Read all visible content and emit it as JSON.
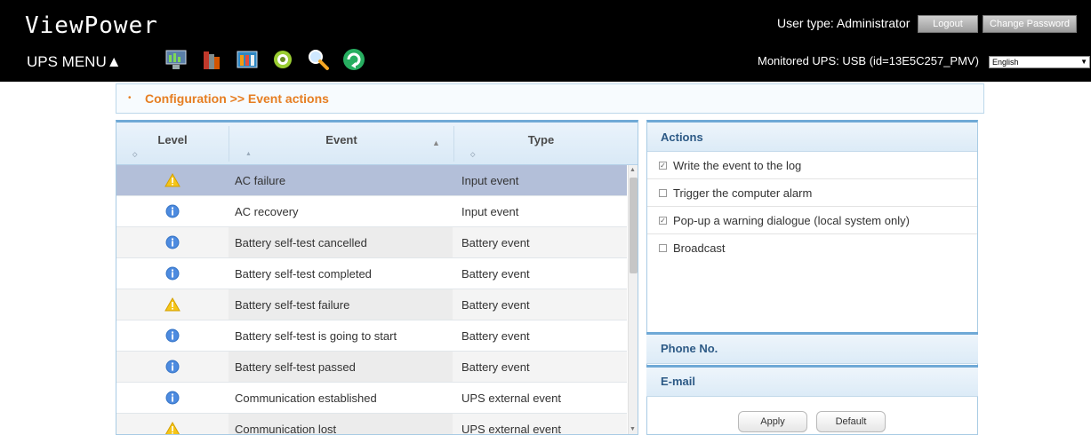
{
  "header": {
    "app_title": "ViewPower",
    "ups_menu": "UPS MENU▲",
    "user_type": "User type: Administrator",
    "logout": "Logout",
    "change_password": "Change Password",
    "monitored": "Monitored UPS: USB (id=13E5C257_PMV)",
    "language": "English",
    "toolbar_icons": [
      "monitor-icon",
      "books-icon",
      "settings-panel-icon",
      "cd-icon",
      "search-icon",
      "refresh-icon"
    ]
  },
  "breadcrumb": {
    "text": "Configuration >> Event actions"
  },
  "table": {
    "headers": {
      "level": "Level",
      "event": "Event",
      "type": "Type"
    },
    "rows": [
      {
        "level": "warning",
        "event": "AC failure",
        "type": "Input event"
      },
      {
        "level": "info",
        "event": "AC recovery",
        "type": "Input event"
      },
      {
        "level": "info",
        "event": "Battery self-test cancelled",
        "type": "Battery event"
      },
      {
        "level": "info",
        "event": "Battery self-test completed",
        "type": "Battery event"
      },
      {
        "level": "warning",
        "event": "Battery self-test failure",
        "type": "Battery event"
      },
      {
        "level": "info",
        "event": "Battery self-test is going to start",
        "type": "Battery event"
      },
      {
        "level": "info",
        "event": "Battery self-test passed",
        "type": "Battery event"
      },
      {
        "level": "info",
        "event": "Communication established",
        "type": "UPS external event"
      },
      {
        "level": "warning",
        "event": "Communication lost",
        "type": "UPS external event"
      }
    ],
    "selected_index": 0
  },
  "actions": {
    "title": "Actions",
    "items": [
      {
        "label": "Write the event to the log",
        "checked": true
      },
      {
        "label": "Trigger the computer alarm",
        "checked": false
      },
      {
        "label": "Pop-up a warning dialogue (local system only)",
        "checked": true
      },
      {
        "label": "Broadcast",
        "checked": false
      }
    ],
    "phone_title": "Phone No.",
    "email_title": "E-mail",
    "apply": "Apply",
    "default": "Default"
  },
  "colors": {
    "accent": "#e67e22",
    "panel_title": "#2d5a86",
    "selected_row": "#b3bfd9"
  }
}
